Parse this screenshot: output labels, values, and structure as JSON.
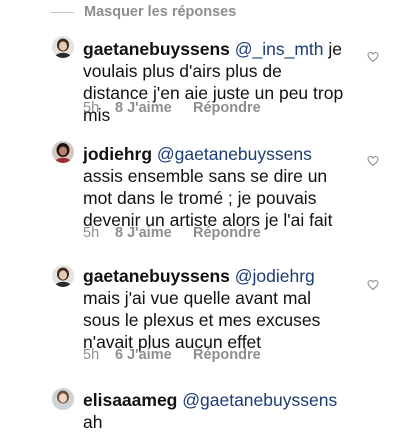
{
  "thread": {
    "toggle_label": "Masquer les réponses"
  },
  "comments": [
    {
      "username": "gaetanebuyssens",
      "mention": "@_ins_mth",
      "text": "je voulais plus d'airs plus de distance j'en aie juste un peu trop mis",
      "time": "5h",
      "likes": "8 J'aime",
      "reply": "Répondre"
    },
    {
      "username": "jodiehrg",
      "mention": "@gaetanebuyssens",
      "text": "assis ensemble sans se dire un mot dans le tromé ; je pouvais devenir un artiste alors je l'ai fait",
      "time": "5h",
      "likes": "8 J'aime",
      "reply": "Répondre"
    },
    {
      "username": "gaetanebuyssens",
      "mention": "@jodiehrg",
      "text": "mais j'ai vue quelle avant mal sous le plexus et mes excuses n'avait plus aucun effet",
      "time": "5h",
      "likes": "6 J'aime",
      "reply": "Répondre"
    },
    {
      "username": "elisaaameg",
      "mention": "@gaetanebuyssens",
      "text": "ah"
    }
  ]
}
